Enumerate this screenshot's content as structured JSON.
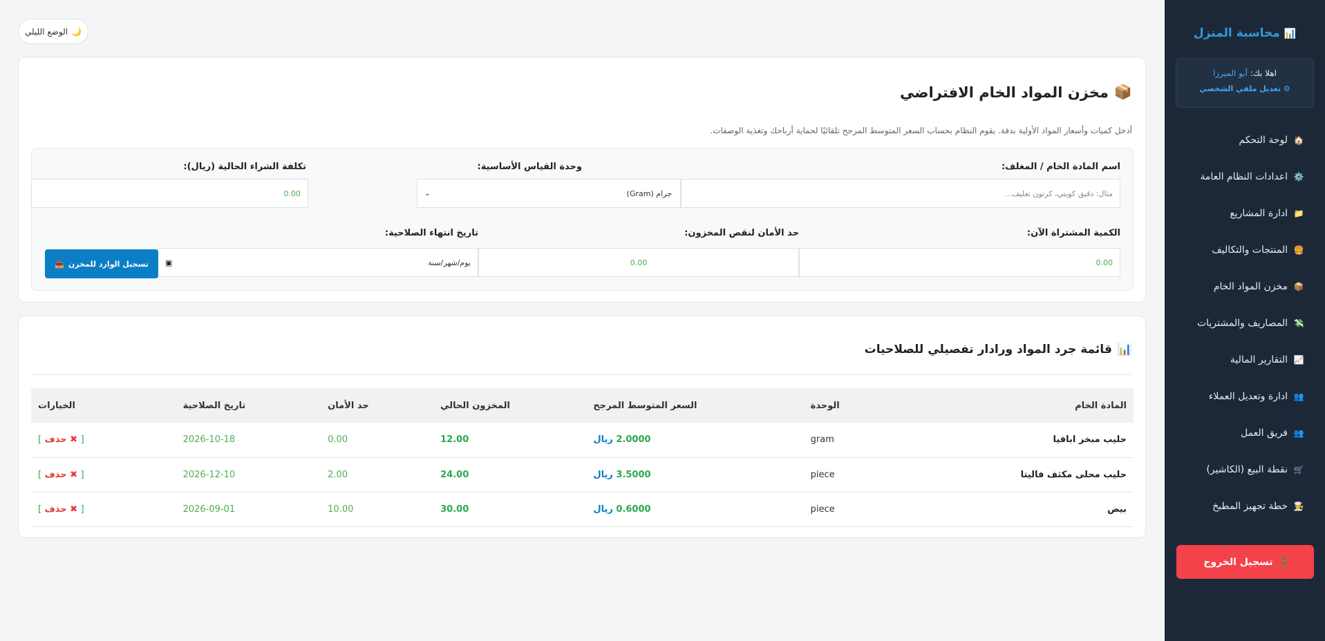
{
  "sidebar": {
    "brand": "محاسبة المنزل",
    "brand_icon": "📊",
    "hello": "اهلا بك:",
    "username": "أبو الميرزا",
    "edit_profile": "تعديل ملفي الشخصي",
    "items": [
      {
        "icon": "🏠",
        "label": "لوحة التحكم"
      },
      {
        "icon": "⚙️",
        "label": "اعدادات النظام العامة"
      },
      {
        "icon": "📁",
        "label": "ادارة المشاريع"
      },
      {
        "icon": "🍔",
        "label": "المنتجات والتكاليف"
      },
      {
        "icon": "📦",
        "label": "مخزن المواد الخام"
      },
      {
        "icon": "💸",
        "label": "المصاريف والمشتريات"
      },
      {
        "icon": "📈",
        "label": "التقارير المالية"
      },
      {
        "icon": "👥",
        "label": "ادارة وتعديل العملاء"
      },
      {
        "icon": "👥",
        "label": "فريق العمل"
      },
      {
        "icon": "🛒",
        "label": "نقطة البيع (الكاشير)"
      },
      {
        "icon": "👨‍🍳",
        "label": "خطة تجهيز المطبخ"
      }
    ],
    "logout": "تسجيل الخروج",
    "logout_icon": "🚪"
  },
  "night_toggle": {
    "label": "الوضع الليلي",
    "icon": "🌙"
  },
  "form_card": {
    "icon": "📦",
    "title": "مخزن المواد الخام الافتراضي",
    "description": "أدخل كميات وأسعار المواد الأولية بدقة. يقوم النظام بحساب السعر المتوسط المرجح تلقائيًا لحماية أرباحك وتغذية الوصفات.",
    "fields": {
      "name_label": "اسم المادة الخام / المغلف:",
      "name_placeholder": "مثال: دقيق كويتي، كرتون تغليف...",
      "unit_label": "وحدة القياس الأساسية:",
      "unit_value": "جرام (Gram)",
      "cost_label": "تكلفة الشراء الحالية (ريال):",
      "cost_placeholder": "0.00",
      "qty_label": "الكمية المشتراة الآن:",
      "qty_placeholder": "0.00",
      "safety_label": "حد الأمان لنقص المخزون:",
      "safety_placeholder": "0.00",
      "expiry_label": "تاريخ انتهاء الصلاحية:",
      "expiry_placeholder": "يوم/شهر/سنة"
    },
    "submit": "تسجيل الوارد للمخزن",
    "submit_icon": "📥"
  },
  "table_card": {
    "icon": "📊",
    "title": "قائمة جرد المواد ورادار تفصيلي للصلاحيات",
    "columns": [
      "المادة الخام",
      "الوحدة",
      "السعر المتوسط المرجح",
      "المخزون الحالي",
      "حد الأمان",
      "تاريخ الصلاحية",
      "الخيارات"
    ],
    "currency": "ريال",
    "delete_label": "حذف",
    "rows": [
      {
        "name": "حليب مبخر ابافيا",
        "unit": "gram",
        "price": "2.0000",
        "stock": "12.00",
        "safety": "0.00",
        "expiry": "2026-10-18"
      },
      {
        "name": "حليب محلى مكثف فاليتا",
        "unit": "piece",
        "price": "3.5000",
        "stock": "24.00",
        "safety": "2.00",
        "expiry": "2026-12-10"
      },
      {
        "name": "بيض",
        "unit": "piece",
        "price": "0.6000",
        "stock": "30.00",
        "safety": "10.00",
        "expiry": "2026-09-01"
      }
    ]
  }
}
